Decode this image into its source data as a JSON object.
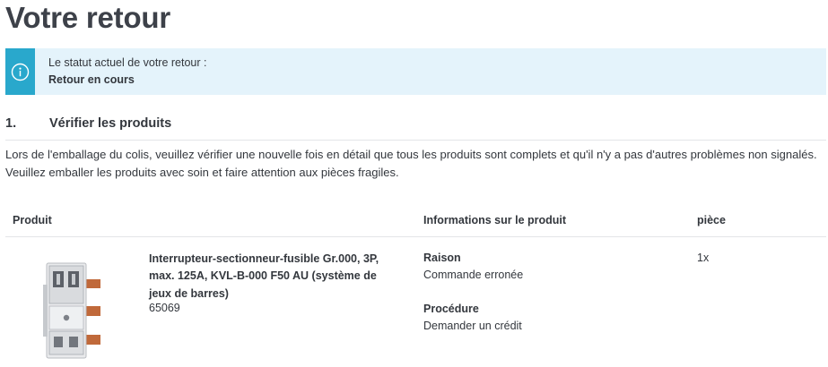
{
  "page": {
    "title": "Votre retour"
  },
  "status": {
    "icon": "info-icon",
    "label": "Le statut actuel de votre retour :",
    "value": "Retour en cours",
    "accent_color": "#29a8cc",
    "background_color": "#e4f3fb"
  },
  "step": {
    "number": "1.",
    "title": "Vérifier les produits",
    "instructions": "Lors de l'emballage du colis, veuillez vérifier une nouvelle fois en détail que tous les produits sont complets et qu'il n'y a pas d'autres problèmes non signalés. Veuillez emballer les produits avec soin et faire attention aux pièces fragiles."
  },
  "table": {
    "headers": {
      "product": "Produit",
      "info": "Informations sur le produit",
      "quantity": "pièce"
    },
    "rows": [
      {
        "image": "fuse-switch-disconnector-image",
        "name": "Interrupteur-sectionneur-fusible Gr.000, 3P, max. 125A, KVL-B-000 F50 AU (système de jeux de barres)",
        "number": "65069",
        "reason_label": "Raison",
        "reason_value": "Commande erronée",
        "procedure_label": "Procédure",
        "procedure_value": "Demander un crédit",
        "quantity": "1x"
      }
    ]
  }
}
